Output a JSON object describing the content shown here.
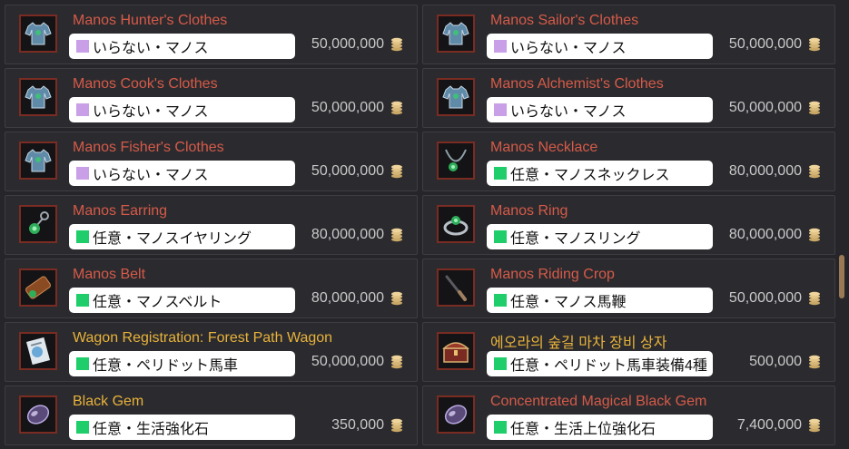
{
  "currency_icon": "silver-coin-stack-icon",
  "colors": {
    "name_red": "#d65a48",
    "name_gold": "#e8b23a",
    "tag_purple": "#c9a0e8",
    "tag_green": "#1fce6a",
    "price_text": "#c9c9c9"
  },
  "items": [
    {
      "name": "Manos Hunter's Clothes",
      "name_color": "red",
      "icon": "clothes-icon",
      "tag_color": "purple",
      "note": "いらない・マノス",
      "price": "50,000,000"
    },
    {
      "name": "Manos Sailor's Clothes",
      "name_color": "red",
      "icon": "clothes-icon",
      "tag_color": "purple",
      "note": "いらない・マノス",
      "price": "50,000,000"
    },
    {
      "name": "Manos Cook's Clothes",
      "name_color": "red",
      "icon": "clothes-icon",
      "tag_color": "purple",
      "note": "いらない・マノス",
      "price": "50,000,000"
    },
    {
      "name": "Manos Alchemist's Clothes",
      "name_color": "red",
      "icon": "clothes-icon",
      "tag_color": "purple",
      "note": "いらない・マノス",
      "price": "50,000,000"
    },
    {
      "name": "Manos Fisher's Clothes",
      "name_color": "red",
      "icon": "clothes-icon",
      "tag_color": "purple",
      "note": "いらない・マノス",
      "price": "50,000,000"
    },
    {
      "name": "Manos Necklace",
      "name_color": "red",
      "icon": "necklace-icon",
      "tag_color": "green",
      "note": "任意・マノスネックレス",
      "price": "80,000,000"
    },
    {
      "name": "Manos Earring",
      "name_color": "red",
      "icon": "earring-icon",
      "tag_color": "green",
      "note": "任意・マノスイヤリング",
      "price": "80,000,000"
    },
    {
      "name": "Manos Ring",
      "name_color": "red",
      "icon": "ring-icon",
      "tag_color": "green",
      "note": "任意・マノスリング",
      "price": "80,000,000"
    },
    {
      "name": "Manos Belt",
      "name_color": "red",
      "icon": "belt-icon",
      "tag_color": "green",
      "note": "任意・マノスベルト",
      "price": "80,000,000"
    },
    {
      "name": "Manos Riding Crop",
      "name_color": "red",
      "icon": "riding-crop-icon",
      "tag_color": "green",
      "note": "任意・マノス馬鞭",
      "price": "50,000,000"
    },
    {
      "name": "Wagon Registration: Forest Path Wagon",
      "name_color": "gold",
      "icon": "registration-document-icon",
      "tag_color": "green",
      "note": "任意・ペリドット馬車",
      "price": "50,000,000"
    },
    {
      "name": "에오라의 숲길 마차 장비 상자",
      "name_color": "gold",
      "icon": "treasure-chest-icon",
      "tag_color": "green",
      "note": "任意・ペリドット馬車装備4種",
      "price": "500,000"
    },
    {
      "name": "Black Gem",
      "name_color": "gold",
      "icon": "black-gem-icon",
      "tag_color": "green",
      "note": "任意・生活強化石",
      "price": "350,000"
    },
    {
      "name": "Concentrated Magical Black Gem",
      "name_color": "red",
      "icon": "black-gem-icon",
      "tag_color": "green",
      "note": "任意・生活上位強化石",
      "price": "7,400,000"
    }
  ]
}
